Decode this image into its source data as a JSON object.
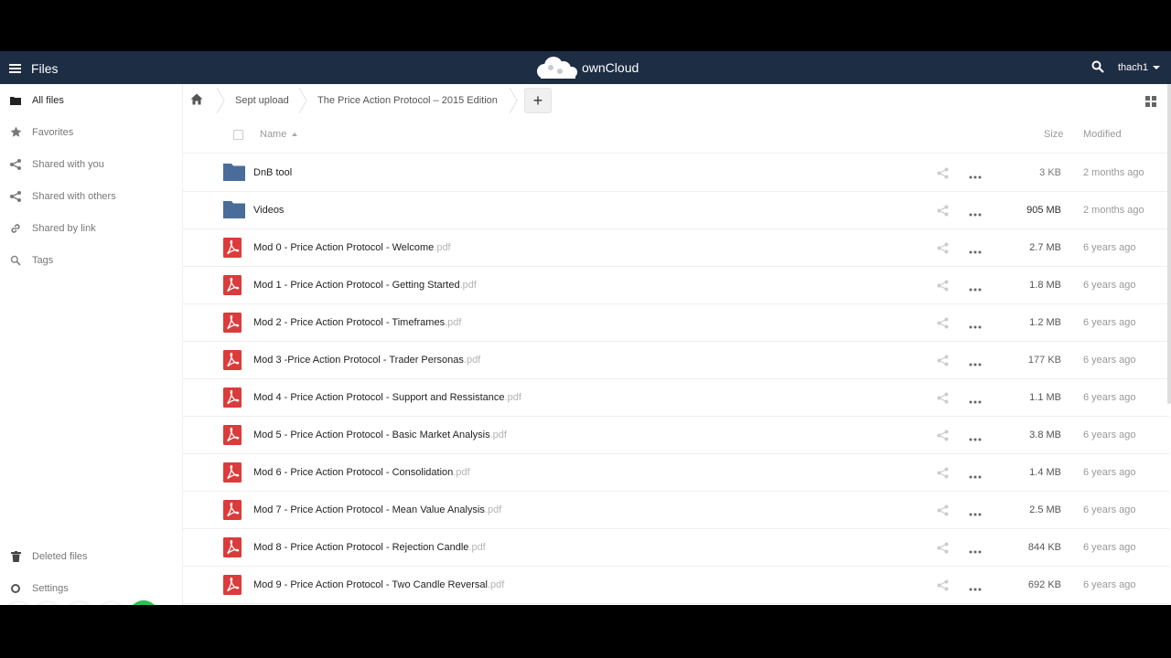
{
  "header": {
    "app_title": "Files",
    "brand": "ownCloud",
    "user": "thach1"
  },
  "sidebar": {
    "items": [
      {
        "label": "All files",
        "icon": "folder-icon"
      },
      {
        "label": "Favorites",
        "icon": "star-icon"
      },
      {
        "label": "Shared with you",
        "icon": "share-icon"
      },
      {
        "label": "Shared with others",
        "icon": "share-icon"
      },
      {
        "label": "Shared by link",
        "icon": "link-icon"
      },
      {
        "label": "Tags",
        "icon": "tag-search-icon"
      }
    ],
    "deleted_files": "Deleted files",
    "settings": "Settings"
  },
  "breadcrumb": {
    "items": [
      "Sept upload",
      "The Price Action Protocol – 2015 Edition"
    ],
    "new_button": "+"
  },
  "table": {
    "headers": {
      "name": "Name",
      "size": "Size",
      "modified": "Modified"
    },
    "rows": [
      {
        "type": "folder",
        "name": "DnB tool",
        "ext": "",
        "size": "3 KB",
        "modified": "2 months ago"
      },
      {
        "type": "folder",
        "name": "Videos",
        "ext": "",
        "size": "905 MB",
        "modified": "2 months ago"
      },
      {
        "type": "pdf",
        "name": "Mod 0 - Price Action Protocol - Welcome",
        "ext": ".pdf",
        "size": "2.7 MB",
        "modified": "6 years ago"
      },
      {
        "type": "pdf",
        "name": "Mod 1 - Price Action Protocol - Getting Started",
        "ext": ".pdf",
        "size": "1.8 MB",
        "modified": "6 years ago"
      },
      {
        "type": "pdf",
        "name": "Mod 2 - Price Action Protocol - Timeframes",
        "ext": ".pdf",
        "size": "1.2 MB",
        "modified": "6 years ago"
      },
      {
        "type": "pdf",
        "name": "Mod 3 -Price Action Protocol - Trader Personas",
        "ext": ".pdf",
        "size": "177 KB",
        "modified": "6 years ago"
      },
      {
        "type": "pdf",
        "name": "Mod 4 - Price Action Protocol - Support and Ressistance",
        "ext": ".pdf",
        "size": "1.1 MB",
        "modified": "6 years ago"
      },
      {
        "type": "pdf",
        "name": "Mod 5 - Price Action Protocol - Basic Market Analysis",
        "ext": ".pdf",
        "size": "3.8 MB",
        "modified": "6 years ago"
      },
      {
        "type": "pdf",
        "name": "Mod 6 - Price Action Protocol - Consolidation",
        "ext": ".pdf",
        "size": "1.4 MB",
        "modified": "6 years ago"
      },
      {
        "type": "pdf",
        "name": "Mod 7 - Price Action Protocol - Mean Value Analysis",
        "ext": ".pdf",
        "size": "2.5 MB",
        "modified": "6 years ago"
      },
      {
        "type": "pdf",
        "name": "Mod 8 - Price Action Protocol - Rejection Candle",
        "ext": ".pdf",
        "size": "844 KB",
        "modified": "6 years ago"
      },
      {
        "type": "pdf",
        "name": "Mod 9 - Price Action Protocol - Two Candle Reversal",
        "ext": ".pdf",
        "size": "692 KB",
        "modified": "6 years ago"
      }
    ]
  },
  "floating_toolbar": {
    "icons": [
      "more-icon",
      "camera-icon",
      "close-icon",
      "pause-icon",
      "check-icon"
    ]
  },
  "colors": {
    "header_bg": "#1d2d44",
    "folder": "#4a6c9b",
    "pdf": "#dc3b3b",
    "confirm": "#2bc253"
  }
}
